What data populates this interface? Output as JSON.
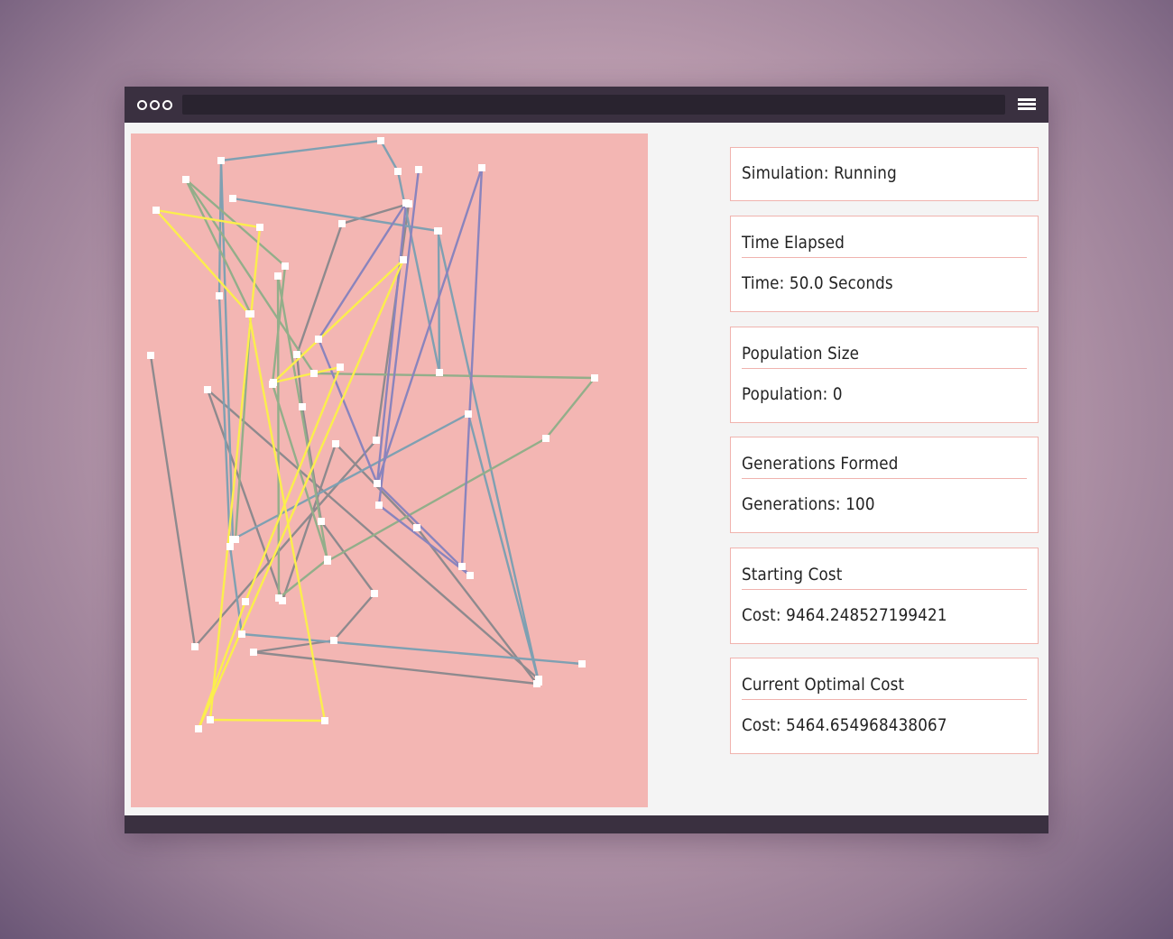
{
  "colors": {
    "background": "#c3a3b4",
    "window_bar": "#3a3040",
    "canvas": "#f3b6b3",
    "panel_border": "#f0b3ae",
    "route_gray": "#8e8a8e",
    "route_teal": "#7fa0b2",
    "route_green": "#93ae8a",
    "route_purple": "#8a84bd",
    "route_yellow": "#fbee4d"
  },
  "window": {
    "dots_icon": "window-dots-icon",
    "menu_icon": "hamburger-menu-icon"
  },
  "status": {
    "simulation": "Simulation: Running"
  },
  "stats": [
    {
      "heading": "Time Elapsed",
      "value": "Time: 50.0 Seconds"
    },
    {
      "heading": "Population Size",
      "value": "Population: 0"
    },
    {
      "heading": "Generations Formed",
      "value": "Generations: 100"
    },
    {
      "heading": "Starting Cost",
      "value": "Cost: 9464.248527199421"
    },
    {
      "heading": "Current Optimal Cost",
      "value": "Cost: 5464.654968438067"
    }
  ]
}
